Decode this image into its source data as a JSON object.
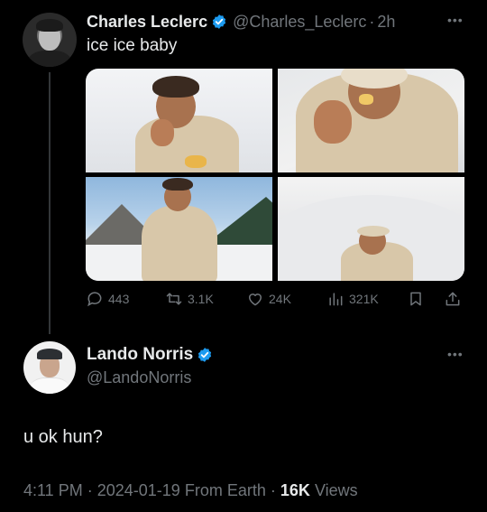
{
  "parent_tweet": {
    "author_name": "Charles Leclerc",
    "handle": "@Charles_Leclerc",
    "separator": "·",
    "time_ago": "2h",
    "more_icon": "more-horizontal-icon",
    "text": "ice ice baby",
    "media_count": 4,
    "stats": {
      "replies": "443",
      "retweets": "3.1K",
      "likes": "24K",
      "views": "321K"
    }
  },
  "reply_tweet": {
    "author_name": "Lando Norris",
    "handle": "@LandoNorris",
    "more_icon": "more-horizontal-icon",
    "text": "u ok hun?",
    "time": "4:11 PM",
    "date": "2024-01-19",
    "source": "From Earth",
    "views_count": "16K",
    "views_label": "Views",
    "separator": "·"
  },
  "colors": {
    "background": "#000000",
    "primary_text": "#e7e9ea",
    "secondary_text": "#71767b",
    "verified": "#1d9bf0",
    "thread_line": "#333639"
  }
}
